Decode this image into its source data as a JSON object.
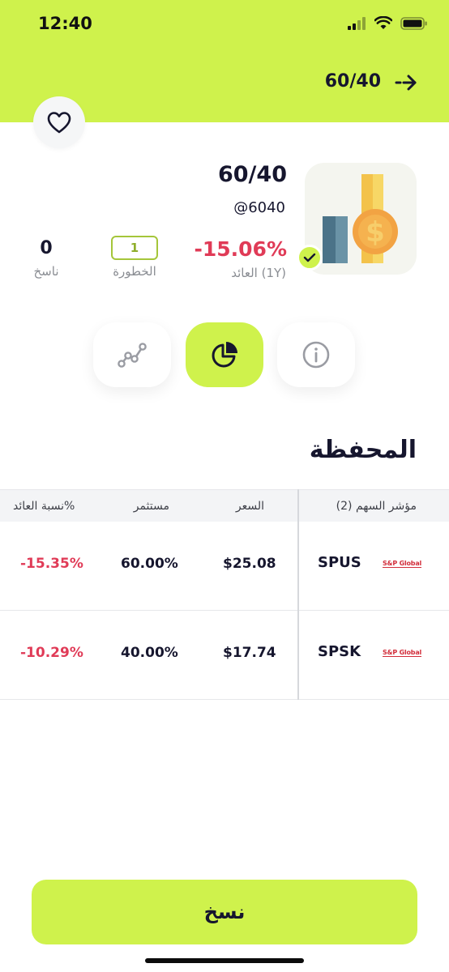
{
  "status_bar": {
    "time": "12:40"
  },
  "header": {
    "title": "60/40"
  },
  "portfolio": {
    "name": "60/40",
    "handle": "@6040",
    "return_value": "-15.06%",
    "return_label": "العائد (1Y)",
    "risk_value": "1",
    "risk_label": "الخطورة",
    "copies_value": "0",
    "copies_label": "ناسخ"
  },
  "tabs": [
    {
      "icon": "info-icon",
      "active": false
    },
    {
      "icon": "pie-chart-icon",
      "active": true
    },
    {
      "icon": "line-chart-icon",
      "active": false
    }
  ],
  "section": {
    "title": "المحفظة"
  },
  "table": {
    "headers": {
      "symbol": "مؤشر السهم (2)",
      "price": "السعر",
      "invested": "مستثمر",
      "return_pct": "نسبة العائد%"
    },
    "rows": [
      {
        "symbol": "SPUS",
        "logo_text": "S&P Global",
        "price": "$25.08",
        "invested": "60.00%",
        "return_pct": "-15.35%"
      },
      {
        "symbol": "SPSK",
        "logo_text": "S&P Global",
        "price": "$17.74",
        "invested": "40.00%",
        "return_pct": "-10.29%"
      }
    ]
  },
  "actions": {
    "copy_label": "نسخ"
  },
  "colors": {
    "accent": "#cff24c",
    "negative": "#e03b57",
    "text": "#16162e",
    "muted": "#8a8d93"
  }
}
